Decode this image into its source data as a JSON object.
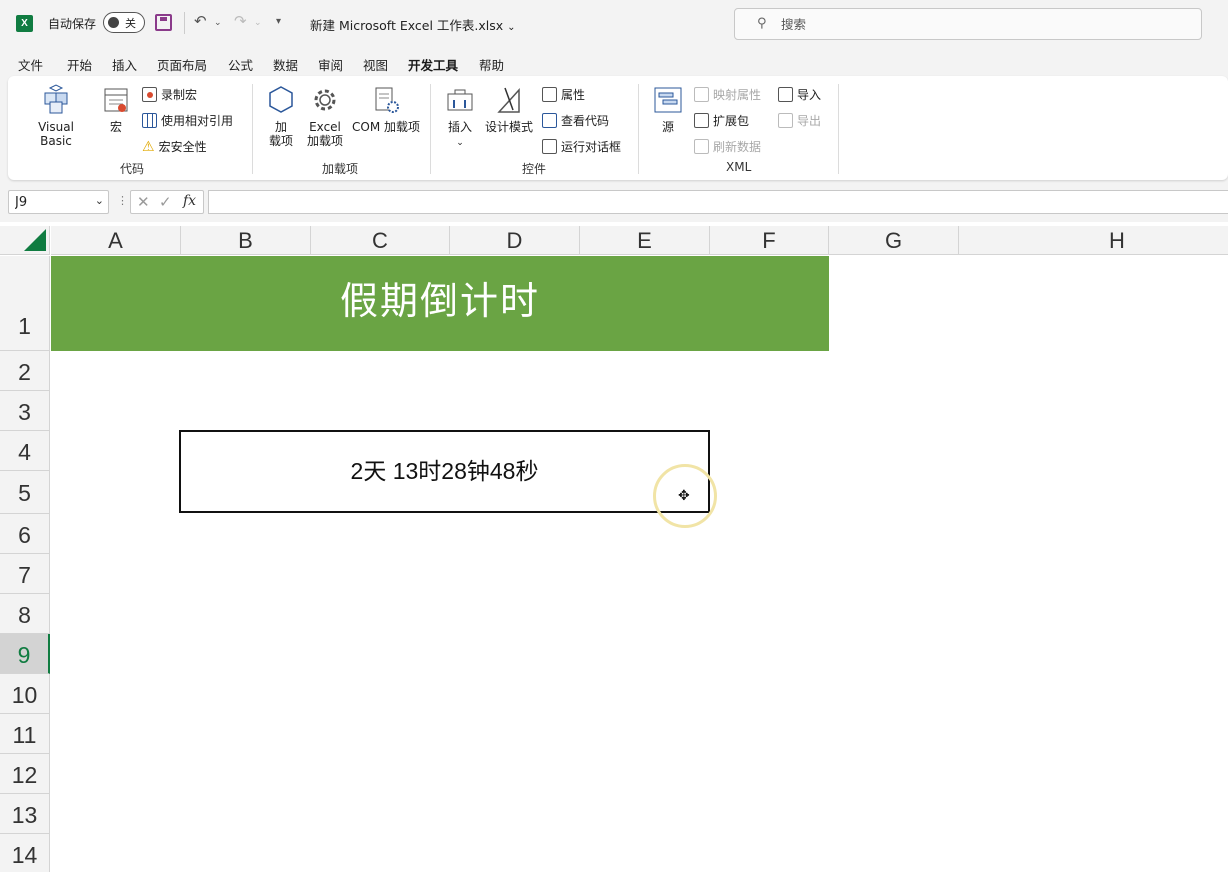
{
  "window": {
    "app_icon": "excel-logo-icon",
    "app_icon_letter": "X",
    "autosave_label": "自动保存",
    "autosave_state": "关",
    "document_title": "新建 Microsoft Excel 工作表.xlsx",
    "search_placeholder": "搜索"
  },
  "menu": {
    "tabs": [
      "文件",
      "开始",
      "插入",
      "页面布局",
      "公式",
      "数据",
      "审阅",
      "视图",
      "开发工具",
      "帮助"
    ],
    "active_tab": "开发工具"
  },
  "ribbon": {
    "code": {
      "label": "代码",
      "visual_basic": "Visual Basic",
      "macros": "宏",
      "record_macro": "录制宏",
      "relative_refs": "使用相对引用",
      "macro_security": "宏安全性"
    },
    "addins": {
      "label": "加载项",
      "addins_line1": "加",
      "addins_line2": "载项",
      "excel_addins_line1": "Excel",
      "excel_addins_line2": "加载项",
      "com_addins": "COM 加载项"
    },
    "controls": {
      "label": "控件",
      "insert": "插入",
      "design_mode": "设计模式",
      "properties": "属性",
      "view_code": "查看代码",
      "run_dialog": "运行对话框"
    },
    "xml": {
      "label": "XML",
      "source": "源",
      "map_properties": "映射属性",
      "expansion_packs": "扩展包",
      "refresh_data": "刷新数据",
      "import": "导入",
      "export": "导出"
    }
  },
  "formula_bar": {
    "name_box": "J9",
    "fx": "fx",
    "formula": ""
  },
  "sheet": {
    "columns": [
      "A",
      "B",
      "C",
      "D",
      "E",
      "F",
      "G",
      "H"
    ],
    "rows": [
      "1",
      "2",
      "3",
      "4",
      "5",
      "6",
      "7",
      "8",
      "9",
      "10",
      "11",
      "12",
      "13",
      "14"
    ],
    "selected_row": "9",
    "banner_title": "假期倒计时",
    "countdown_text": "2天 13时28钟48秒",
    "banner_color": "#6aa444",
    "accent_color": "#107c41"
  }
}
